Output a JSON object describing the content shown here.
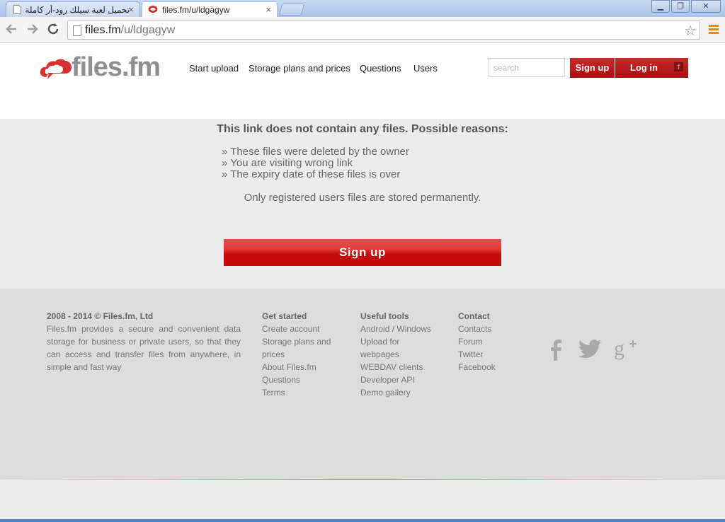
{
  "browser": {
    "tabs": [
      {
        "title": "تحميل لعبة سيلك رود-أر كاملة",
        "close": "×"
      },
      {
        "title": "files.fm/u/ldgagyw",
        "close": "×"
      }
    ],
    "url_host": "files.fm",
    "url_path": "/u/ldgagyw",
    "window_buttons": {
      "minimize": "▁",
      "restore": "❐",
      "close": "✕"
    }
  },
  "header": {
    "logo_text": "files.fm",
    "nav": [
      "Start upload",
      "Storage plans and prices",
      "Questions",
      "Users"
    ],
    "search_placeholder": "search",
    "signup_label": "Sign up",
    "login_label": "Log in",
    "fb_glyph": "f"
  },
  "main": {
    "heading": "This link does not contain any files. Possible reasons:",
    "reasons": [
      "» These files were deleted by the owner",
      "» You are visiting wrong link",
      "» The expiry date of these files is over"
    ],
    "note": "Only registered users files are stored permanently.",
    "signup_button": "Sign up"
  },
  "footer": {
    "copyright": "2008 - 2014 © Files.fm, Ltd",
    "about": "Files.fm provides a secure and convenient data storage for business or private users, so that they can access and transfer files from anywhere, in simple and fast way",
    "columns": [
      {
        "title": "Get started",
        "links": [
          "Create account",
          "Storage plans and prices",
          "About Files.fm",
          "Questions",
          "Terms"
        ]
      },
      {
        "title": "Useful tools",
        "links": [
          "Android / Windows",
          "Upload for webpages",
          "WEBDAV clients",
          "Developer API",
          "Demo gallery"
        ]
      },
      {
        "title": "Contact",
        "links": [
          "Contacts",
          "Forum",
          "Twitter",
          "Facebook"
        ]
      }
    ],
    "social": {
      "facebook": "f",
      "googleplus": "g+"
    }
  },
  "colors": {
    "brand_red": "#c51a1a",
    "footer_bg": "#dcdcdc",
    "page_bg": "#ececec"
  },
  "icons": [
    "back-arrow-icon",
    "forward-arrow-icon",
    "reload-icon",
    "page-icon",
    "star-icon",
    "menu-icon",
    "facebook-icon",
    "twitter-icon",
    "googleplus-icon"
  ]
}
